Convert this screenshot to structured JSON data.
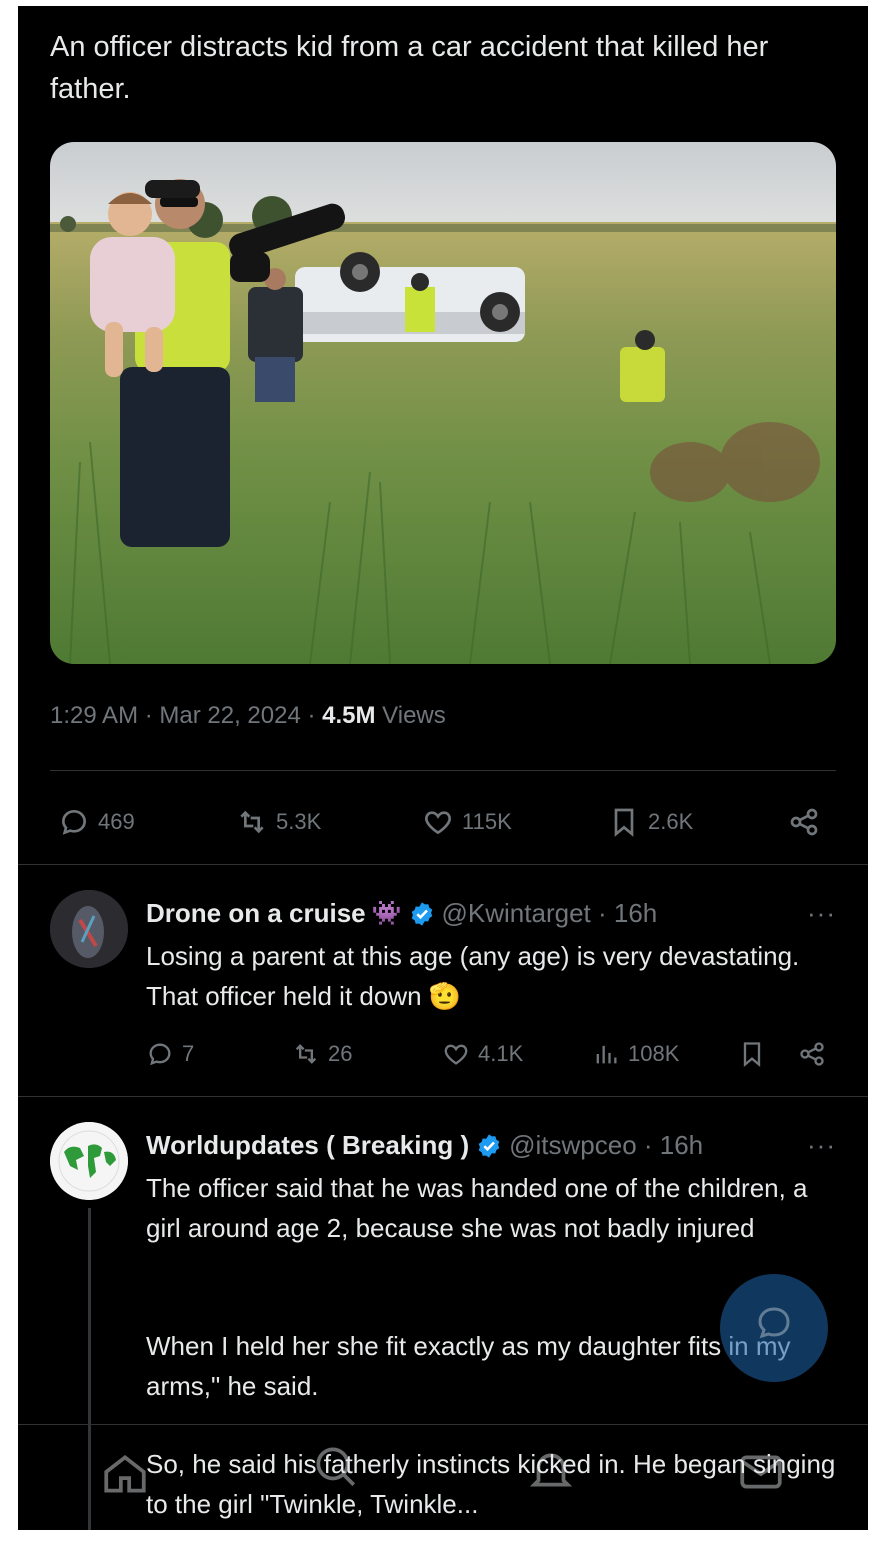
{
  "post": {
    "text": "An officer distracts kid from a car accident that killed her father.",
    "timestamp": "1:29 AM · Mar 22, 2024 · ",
    "views_count": "4.5M",
    "views_label": " Views",
    "stats": {
      "replies": "469",
      "reposts": "5.3K",
      "likes": "115K",
      "bookmarks": "2.6K"
    }
  },
  "replies": [
    {
      "name": "Drone on a cruise",
      "handle": "@Kwintarget · 16h",
      "text": "Losing a parent at this age (any age) is very devastating. That officer held it down",
      "emoji": "🫡",
      "more": "···",
      "stats": {
        "replies": "7",
        "reposts": "26",
        "likes": "4.1K",
        "views": "108K"
      }
    },
    {
      "name": "Worldupdates ( Breaking )",
      "handle": "@itswpceo · 16h",
      "more": "···",
      "paragraph1": "The officer said that he was handed one of the children, a girl around age 2, because she was not badly injured",
      "paragraph2": "When I held her she fit exactly as my daughter fits in my arms,\" he said.",
      "paragraph3": "So, he said his fatherly instincts kicked in. He began singing to the girl \"Twinkle, Twinkle..."
    }
  ],
  "colors": {
    "background": "#000000",
    "text": "#e7e9ea",
    "muted": "#71767b",
    "verified": "#1d9bf0",
    "divider": "#2f3336"
  },
  "icons": [
    "reply-icon",
    "repost-icon",
    "like-icon",
    "bookmark-icon",
    "share-icon",
    "views-icon",
    "verified-icon",
    "home-icon",
    "search-icon",
    "notifications-icon",
    "messages-icon",
    "compose-icon"
  ]
}
